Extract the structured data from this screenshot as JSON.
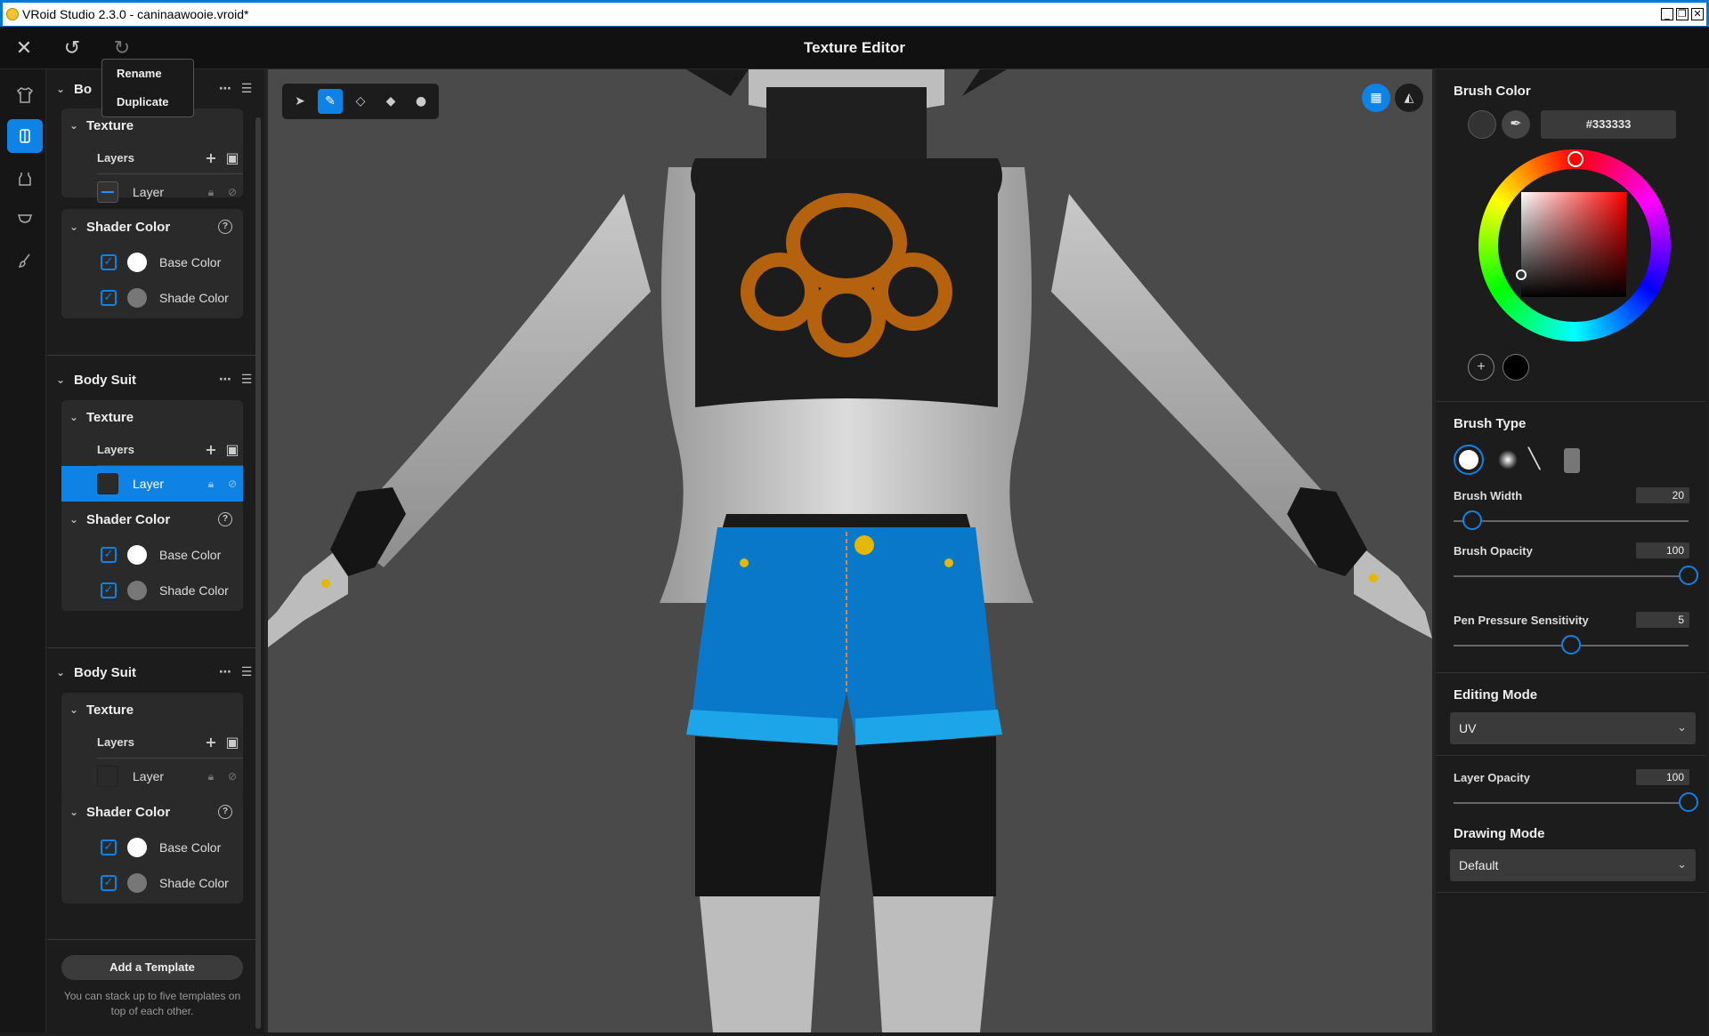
{
  "window": {
    "title": "VRoid Studio 2.3.0 - caninaawooie.vroid*",
    "buttons": [
      "_",
      "❐",
      "✕"
    ]
  },
  "header": {
    "title": "Texture Editor",
    "icons": [
      "close-icon",
      "undo-icon",
      "redo-icon"
    ]
  },
  "rail": {
    "icons": [
      "shirt-icon",
      "bodysuit-icon",
      "top-icon",
      "bottom-icon",
      "brush-icon"
    ],
    "active_index": 1
  },
  "context_menu": {
    "items": [
      "Rename",
      "Duplicate"
    ]
  },
  "sections": [
    {
      "title": "Bo",
      "texture_label": "Texture",
      "layers_label": "Layers",
      "layer_name": "Layer",
      "shader_label": "Shader Color",
      "base_label": "Base Color",
      "shade_label": "Shade Color"
    },
    {
      "title": "Body Suit",
      "texture_label": "Texture",
      "layers_label": "Layers",
      "layer_name": "Layer",
      "shader_label": "Shader Color",
      "base_label": "Base Color",
      "shade_label": "Shade Color"
    },
    {
      "title": "Body Suit",
      "texture_label": "Texture",
      "layers_label": "Layers",
      "layer_name": "Layer",
      "shader_label": "Shader Color",
      "base_label": "Base Color",
      "shade_label": "Shade Color"
    }
  ],
  "add_template": {
    "label": "Add a Template",
    "note": "You can stack up to five templates on top of each other."
  },
  "tools": [
    "select-tool-icon",
    "pen-tool-icon",
    "eraser-tool-icon",
    "fill-tool-icon",
    "dropper-tool-icon"
  ],
  "active_tool": 1,
  "brush_color": {
    "title": "Brush Color",
    "hex": "#333333",
    "current": "#333333"
  },
  "brush_type": {
    "title": "Brush Type"
  },
  "brush_width": {
    "label": "Brush Width",
    "value": "20",
    "fraction": 0.08
  },
  "brush_opacity": {
    "label": "Brush Opacity",
    "value": "100",
    "fraction": 1.0
  },
  "pen_pressure": {
    "label": "Pen Pressure Sensitivity",
    "value": "5",
    "fraction": 0.5
  },
  "editing_mode": {
    "title": "Editing Mode",
    "value": "UV"
  },
  "layer_opacity": {
    "label": "Layer Opacity",
    "value": "100",
    "fraction": 1.0
  },
  "drawing_mode": {
    "title": "Drawing Mode",
    "value": "Default"
  },
  "colors": {
    "accent": "#0f82e6",
    "base_color": "#ffffff",
    "shade_color": "#777777",
    "shirt_emblem": "#b5620e",
    "shorts": "#0a78c8"
  }
}
